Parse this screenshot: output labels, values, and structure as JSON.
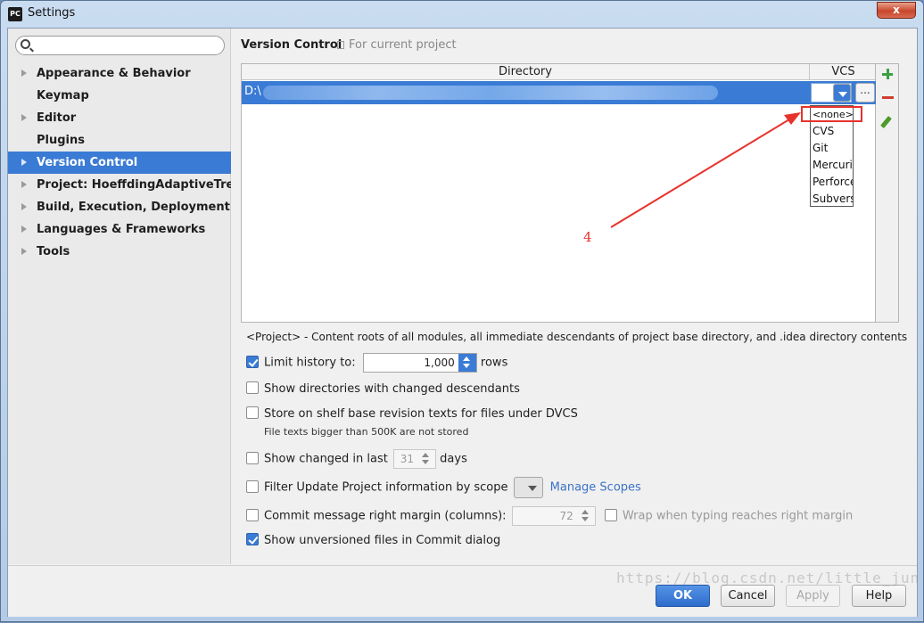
{
  "window": {
    "title": "Settings",
    "app_icon_label": "PC",
    "close_label": "x"
  },
  "search": {
    "placeholder": "",
    "value": ""
  },
  "sidebar": {
    "items": [
      {
        "label": "Appearance & Behavior",
        "expandable": true,
        "selected": false
      },
      {
        "label": "Keymap",
        "expandable": false,
        "selected": false
      },
      {
        "label": "Editor",
        "expandable": true,
        "selected": false
      },
      {
        "label": "Plugins",
        "expandable": false,
        "selected": false
      },
      {
        "label": "Version Control",
        "expandable": true,
        "selected": true
      },
      {
        "label": "Project: HoeffdingAdaptiveTree...",
        "expandable": true,
        "selected": false
      },
      {
        "label": "Build, Execution, Deployment",
        "expandable": true,
        "selected": false
      },
      {
        "label": "Languages & Frameworks",
        "expandable": true,
        "selected": false
      },
      {
        "label": "Tools",
        "expandable": true,
        "selected": false
      }
    ]
  },
  "main": {
    "title": "Version Control",
    "scope_label": "For current project",
    "table": {
      "columns": [
        "Directory",
        "VCS"
      ],
      "rows": [
        {
          "directory": "D:\\",
          "vcs": ""
        }
      ]
    },
    "vcs_dropdown": {
      "options": [
        "<none>",
        "CVS",
        "Git",
        "Mercuri",
        "Perforce",
        "Subvers"
      ],
      "selected": "<none>"
    },
    "annotation": {
      "number": "4",
      "color": "#e8322c"
    },
    "description": "<Project> - Content roots of all modules, all immediate descendants of project base directory, and .idea directory contents",
    "options": {
      "limit_history": {
        "label": "Limit history to:",
        "checked": true,
        "value": "1,000",
        "suffix": "rows"
      },
      "show_dirs": {
        "label": "Show directories with changed descendants",
        "checked": false
      },
      "store_shelf": {
        "label": "Store on shelf base revision texts for files under DVCS",
        "checked": false,
        "hint": "File texts bigger than 500K are not stored"
      },
      "show_changed": {
        "label": "Show changed in last",
        "checked": false,
        "value": "31",
        "suffix": "days"
      },
      "filter_update": {
        "label": "Filter Update Project information by scope",
        "checked": false,
        "link": "Manage Scopes"
      },
      "commit_margin": {
        "label": "Commit message right margin (columns):",
        "checked": false,
        "value": "72",
        "wrap_label": "Wrap when typing reaches right margin",
        "wrap_checked": false
      },
      "show_unversioned": {
        "label": "Show unversioned files in Commit dialog",
        "checked": true
      }
    }
  },
  "footer": {
    "ok": "OK",
    "cancel": "Cancel",
    "apply": "Apply",
    "help": "Help"
  },
  "watermark": "https://blog.csdn.net/little_jun",
  "colors": {
    "accent": "#3a7bd5",
    "annotation": "#e8322c"
  }
}
